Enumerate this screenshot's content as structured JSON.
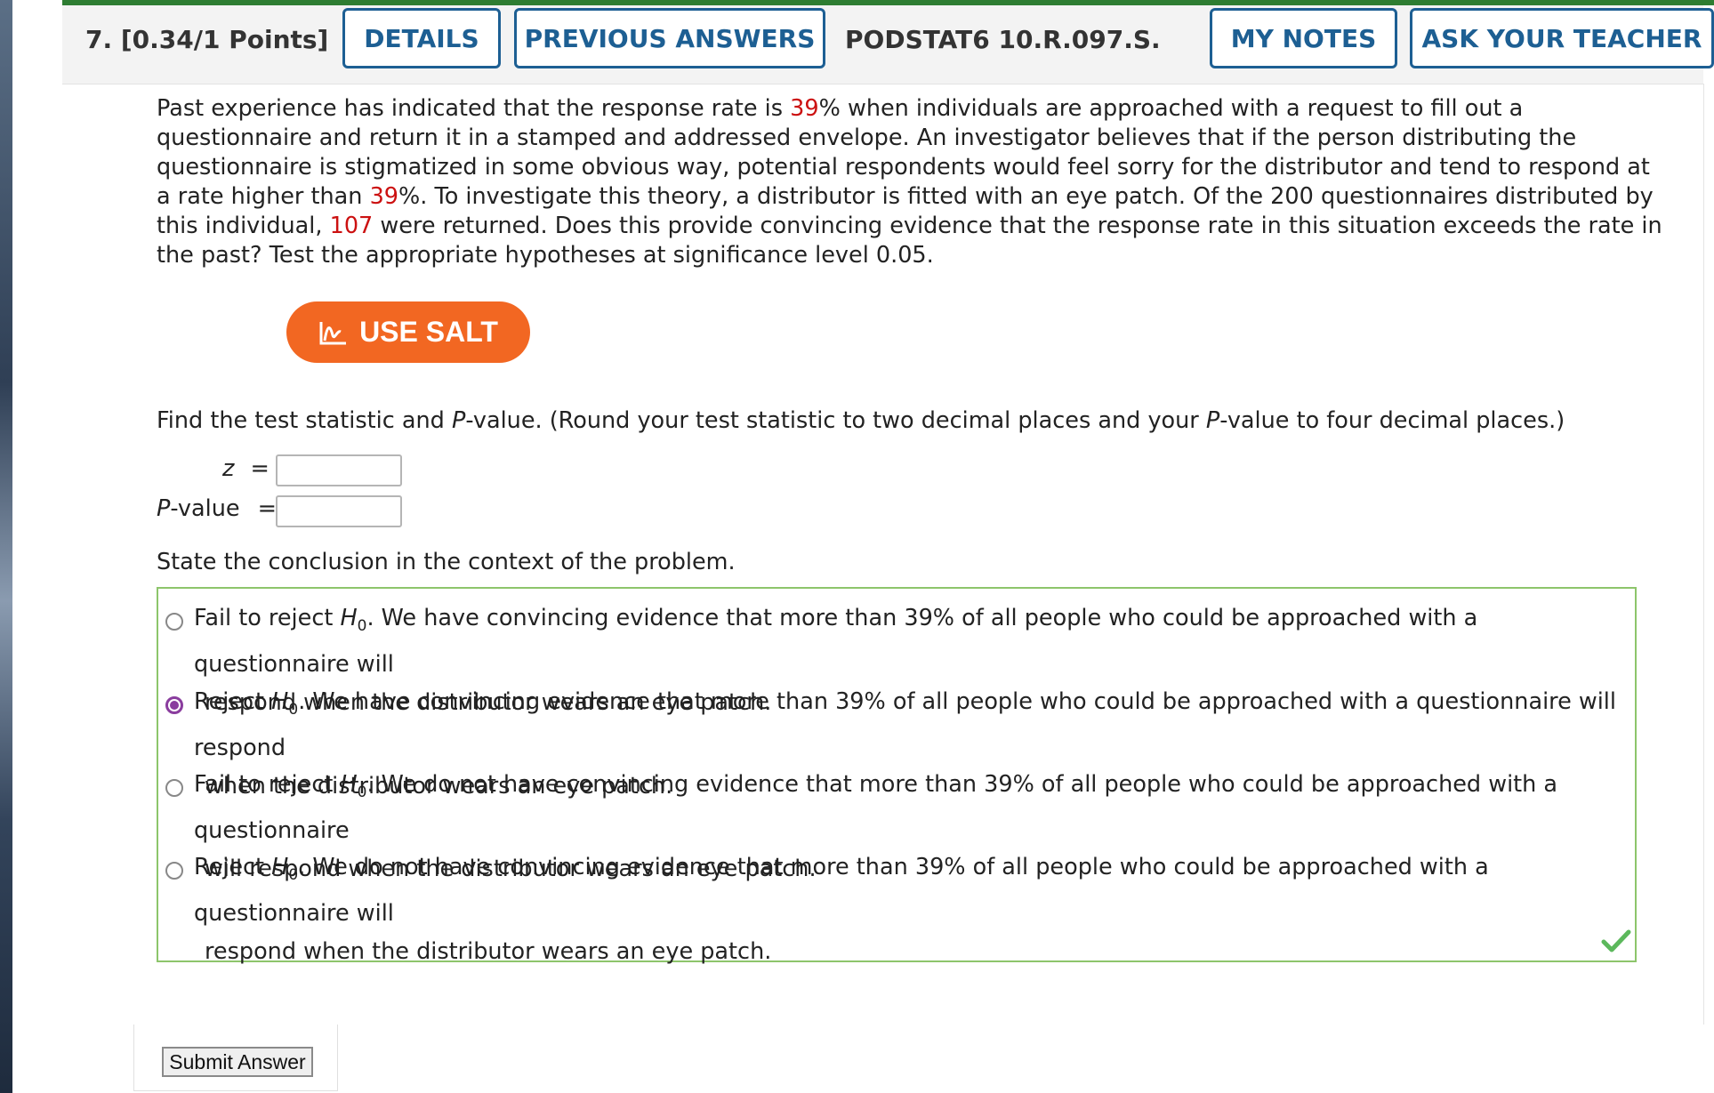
{
  "header": {
    "question_number": "7.",
    "points": "[0.34/1 Points]",
    "details_label": "DETAILS",
    "previous_answers_label": "PREVIOUS ANSWERS",
    "problem_code": "PODSTAT6 10.R.097.S.",
    "my_notes_label": "MY NOTES",
    "ask_teacher_label": "ASK YOUR TEACHER"
  },
  "problem": {
    "seg1": "Past experience has indicated that the response rate is ",
    "rate1": "39",
    "seg2": "% when individuals are approached with a request to fill out a questionnaire and return it in a stamped and addressed envelope. An investigator believes that if the person distributing the questionnaire is stigmatized in some obvious way, potential respondents would feel sorry for the distributor and tend to respond at a rate higher than ",
    "rate2": "39",
    "seg3": "%. To investigate this theory, a distributor is fitted with an eye patch. Of the 200 questionnaires distributed by this individual, ",
    "returned": "107",
    "seg4": " were returned. Does this provide convincing evidence that the response rate in this situation exceeds the rate in the past? Test the appropriate hypotheses at significance level 0.05."
  },
  "salt_button_label": "USE SALT",
  "find_prompt": {
    "p1": "Find the test statistic and ",
    "p_italic": "P",
    "p2": "-value. (Round your test statistic to two decimal places and your ",
    "p_italic2": "P",
    "p3": "-value to four decimal places.)"
  },
  "inputs": {
    "z_label": "z",
    "z_value": "",
    "p_label_italic": "P",
    "p_label_rest": "-value",
    "p_value": "",
    "equals": "="
  },
  "conclusion_prompt": "State the conclusion in the context of the problem.",
  "choices": [
    {
      "lead": "Fail to reject ",
      "rest1": ". We have convincing evidence that more than 39% of all people who could be approached with a questionnaire will",
      "line2": "respond when the distributor wears an eye patch.",
      "selected": false
    },
    {
      "lead": "Reject ",
      "rest1": ". We have convincing evidence that more than 39% of all people who could be approached with a questionnaire will respond",
      "line2": "when the distributor wears an eye patch.",
      "selected": true
    },
    {
      "lead": "Fail to reject ",
      "rest1": ". We do not have convincing evidence that more than 39% of all people who could be approached with a questionnaire",
      "line2": "will respond when the distributor wears an eye patch.",
      "selected": false
    },
    {
      "lead": "Reject ",
      "rest1": ". We do not have convincing evidence that more than 39% of all people who could be approached with a questionnaire will",
      "line2": "respond when the distributor wears an eye patch.",
      "selected": false
    }
  ],
  "hypothesis_symbol": "H",
  "hypothesis_sub": "0",
  "submit_label": "Submit Answer",
  "colors": {
    "accent_blue": "#1d5f93",
    "salt_orange": "#f26722",
    "highlight_red": "#cc1111",
    "correct_green": "#5cb85c",
    "selected_radio": "#8a3d9e"
  }
}
